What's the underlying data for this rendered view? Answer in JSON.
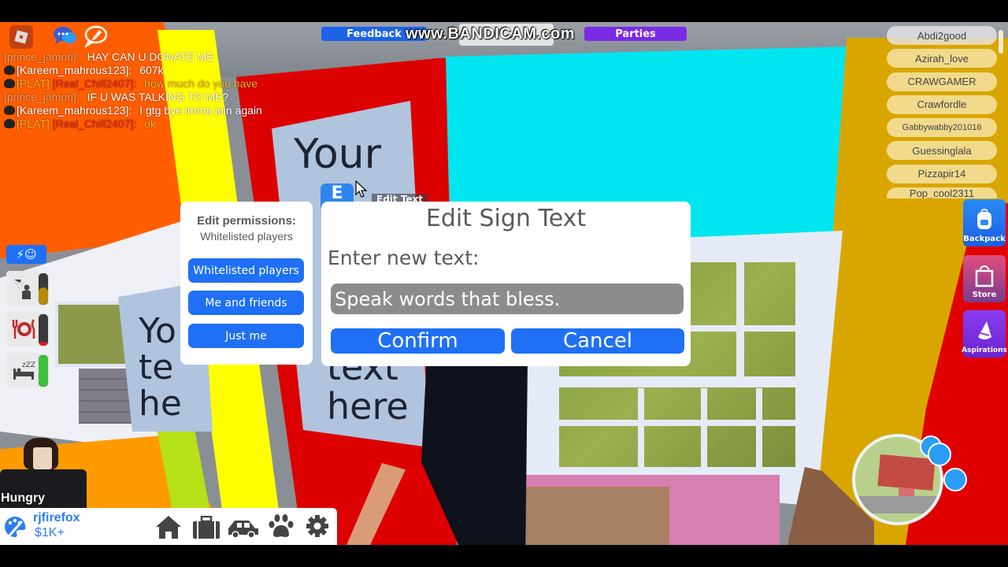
{
  "topbar": {
    "feedback_label": "Feedback",
    "parties_label": "Parties",
    "watermark": "www.BANDICAM.com",
    "icons": [
      "roblox-menu-icon",
      "chat-bubble-icon",
      "emote-pencil-icon"
    ]
  },
  "chat": {
    "messages": [
      {
        "author": "[prince_jamori]:",
        "text": "HAY CAN U DONATE ME",
        "author_color": "#f2a16b",
        "text_color": "#ffffff"
      },
      {
        "author": "[Kareem_mahrous123]:",
        "text": "607k",
        "author_color": "#ffffff",
        "text_color": "#ffffff",
        "badge": true
      },
      {
        "author_tag": "[PLAT]",
        "author": "[Real_Chill2407]:",
        "text": "how much do you have",
        "author_color": "#e0211d",
        "tag_color": "#f0b321",
        "text_color": "#f0b321",
        "badge": true
      },
      {
        "author": "[prince_jamori]:",
        "text": "IF U WAS TALKING TO ME?",
        "author_color": "#f2a16b",
        "text_color": "#ffffff"
      },
      {
        "author": "[Kareem_mahrous123]:",
        "text": "I gtg bye imma join again",
        "author_color": "#ffffff",
        "text_color": "#ffffff",
        "badge": true
      },
      {
        "author_tag": "[PLAT]",
        "author": "[Real_Chill2407]:",
        "text": "ok",
        "author_color": "#e0211d",
        "tag_color": "#f0b321",
        "text_color": "#f0b321",
        "badge": true
      }
    ]
  },
  "players": [
    "Abdi2good",
    "Azirah_love",
    "CRAWGAMER",
    "Crawfordle",
    "Gabbywabby201016",
    "Guessinglala",
    "Pizzapir14",
    "Pop_cool2311"
  ],
  "side_buttons": {
    "backpack": "Backpack",
    "store": "Store",
    "aspirations": "Aspirations"
  },
  "permissions": {
    "title": "Edit permissions:",
    "current": "Whitelisted players",
    "options": [
      "Whitelisted players",
      "Me and friends",
      "Just me"
    ]
  },
  "edit_sign": {
    "title": "Edit Sign Text",
    "prompt": "Enter new text:",
    "input_value": "Speak words that bless.",
    "confirm_label": "Confirm",
    "cancel_label": "Cancel"
  },
  "world": {
    "sign_text_main": [
      "Your",
      "text",
      "here"
    ],
    "sign_text_left": [
      "Yo",
      "te",
      "he"
    ],
    "interact_key": "E",
    "interact_label": "Edit Text"
  },
  "needs": {
    "mood_label": "mood",
    "items": [
      {
        "name": "hygiene",
        "level": 0.55,
        "color": "#b88a08"
      },
      {
        "name": "hunger",
        "level": 0.12,
        "color": "#cf1f1f"
      },
      {
        "name": "energy",
        "level": 1.0,
        "color": "#3cc13c"
      }
    ]
  },
  "character": {
    "status": "Hungry"
  },
  "profile": {
    "username": "rjfirefox",
    "money": "$1K+"
  },
  "bottom_nav": [
    "home",
    "jobs",
    "vehicles",
    "pets",
    "settings"
  ],
  "colors": {
    "accent_blue": "#1f70f5",
    "feedback_blue": "#1c63ea",
    "parties_purple": "#7a2be6",
    "input_gray": "#8c8c8c",
    "dialog_text": "#5a5a5a"
  }
}
